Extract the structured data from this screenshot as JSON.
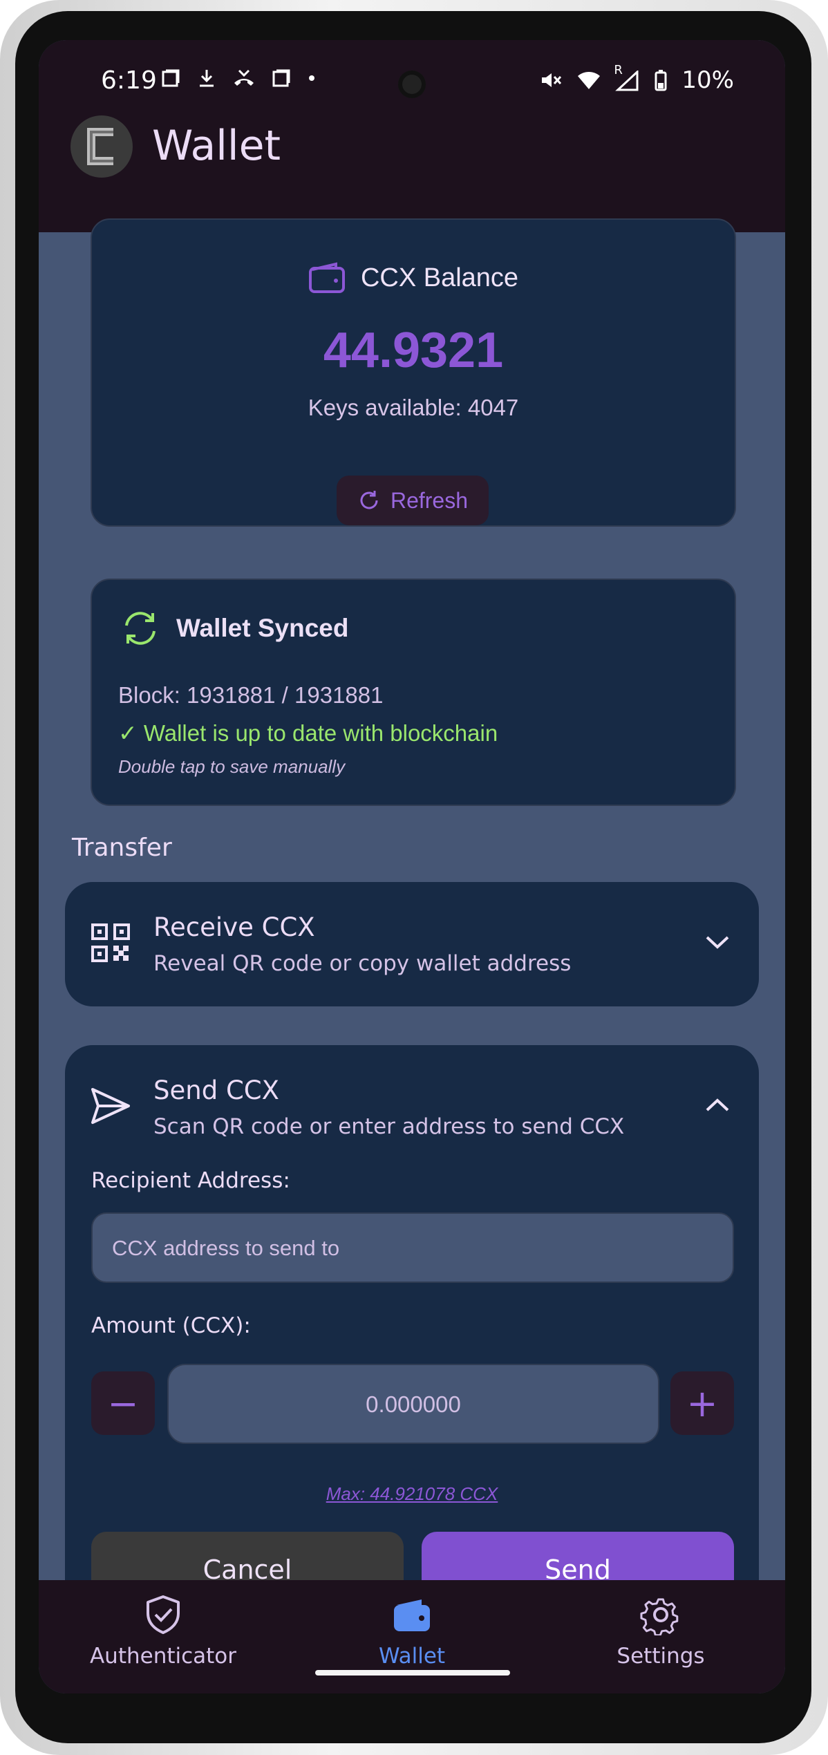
{
  "status_bar": {
    "time": "6:19",
    "battery": "10%",
    "network_badge": "R"
  },
  "app_bar": {
    "title": "Wallet",
    "logo_letter": "C"
  },
  "balance": {
    "title": "CCX Balance",
    "amount": "44.9321",
    "keys_available": "Keys available: 4047",
    "refresh_label": "Refresh"
  },
  "sync": {
    "title": "Wallet Synced",
    "block": "Block: 1931881 / 1931881",
    "status": "✓ Wallet is up to date with blockchain",
    "hint": "Double tap to save manually"
  },
  "transfer": {
    "section_label": "Transfer",
    "receive": {
      "title": "Receive CCX",
      "subtitle": "Reveal QR code or copy wallet address",
      "expanded": false
    },
    "send": {
      "title": "Send CCX",
      "subtitle": "Scan QR code or enter address to send CCX",
      "expanded": true,
      "recipient_label": "Recipient Address:",
      "recipient_placeholder": "CCX address to send to",
      "amount_label": "Amount (CCX):",
      "amount_value": "0.000000",
      "minus": "−",
      "plus": "+",
      "max_label": "Max: 44.921078 CCX",
      "cancel_label": "Cancel",
      "send_label": "Send"
    }
  },
  "bottom_nav": {
    "items": [
      {
        "label": "Authenticator",
        "icon": "shield-check-icon",
        "active": false
      },
      {
        "label": "Wallet",
        "icon": "wallet-icon",
        "active": true
      },
      {
        "label": "Settings",
        "icon": "gear-icon",
        "active": false
      }
    ]
  },
  "colors": {
    "accent": "#8c57d6",
    "card_bg": "#172a45",
    "page_bg": "#465675",
    "bar_bg": "#1d111d",
    "success": "#9ae66d",
    "nav_active": "#5a8ef2"
  }
}
